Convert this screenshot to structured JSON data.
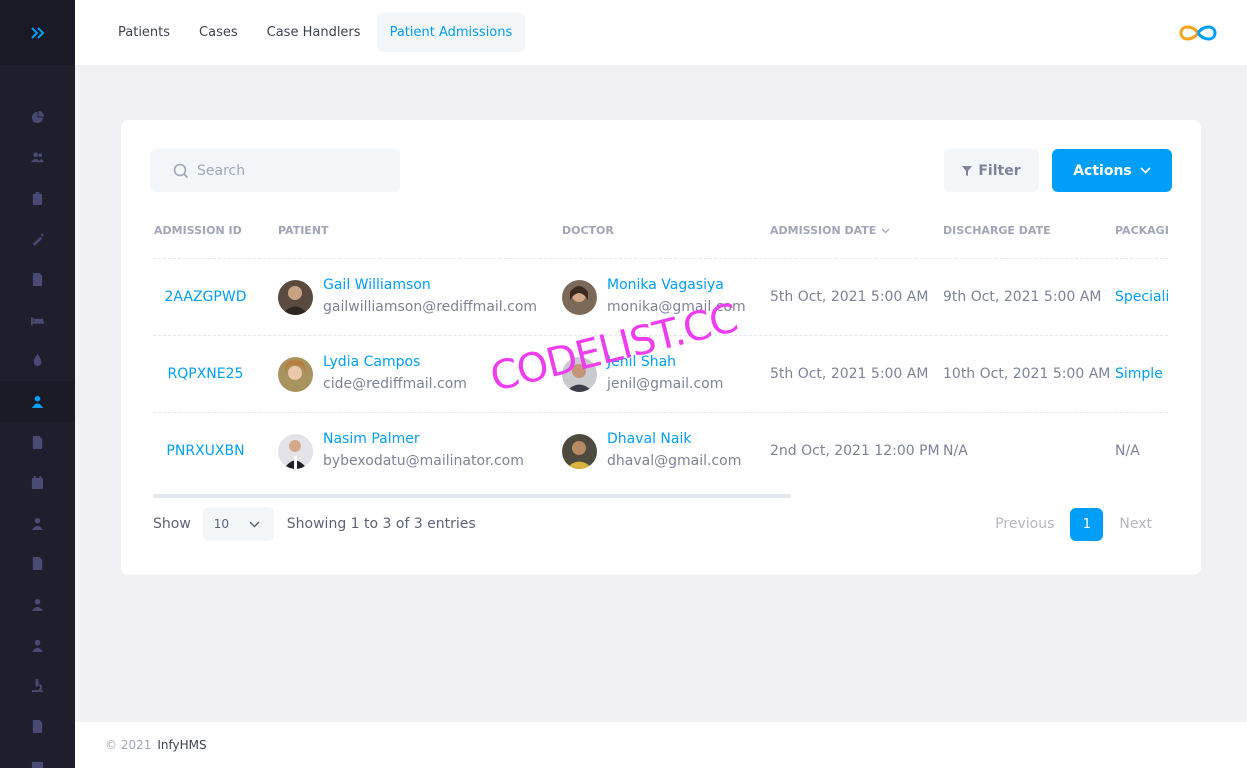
{
  "header": {
    "tabs": [
      {
        "label": "Patients",
        "active": false
      },
      {
        "label": "Cases",
        "active": false
      },
      {
        "label": "Case Handlers",
        "active": false
      },
      {
        "label": "Patient Admissions",
        "active": true
      }
    ],
    "logo_icon": "infinity-logo-icon"
  },
  "sidebar": {
    "toggle_icon": "double-chevron-right-icon",
    "items": [
      {
        "icon": "pie-chart-icon"
      },
      {
        "icon": "users-icon"
      },
      {
        "icon": "clipboard-icon"
      },
      {
        "icon": "syringe-icon"
      },
      {
        "icon": "document-icon"
      },
      {
        "icon": "bed-icon"
      },
      {
        "icon": "blood-drop-icon"
      },
      {
        "icon": "patient-icon",
        "active": true
      },
      {
        "icon": "file-icon"
      },
      {
        "icon": "calendar-icon"
      },
      {
        "icon": "user-doctor-icon"
      },
      {
        "icon": "file-text-icon"
      },
      {
        "icon": "user-nurse-icon"
      },
      {
        "icon": "user-icon"
      },
      {
        "icon": "microscope-icon"
      },
      {
        "icon": "file-medical-icon"
      },
      {
        "icon": "calendar-check-icon"
      }
    ]
  },
  "toolbar": {
    "search_placeholder": "Search",
    "filter_label": "Filter",
    "actions_label": "Actions"
  },
  "table": {
    "columns": [
      "ADMISSION ID",
      "PATIENT",
      "DOCTOR",
      "ADMISSION DATE",
      "DISCHARGE DATE",
      "PACKAGE"
    ],
    "rows": [
      {
        "admission_id": "2AAZGPWD",
        "patient_name": "Gail Williamson",
        "patient_email": "gailwilliamson@rediffmail.com",
        "doctor_name": "Monika Vagasiya",
        "doctor_email": "monika@gmail.com",
        "admission_date": "5th Oct, 2021 5:00 AM",
        "discharge_date": "9th Oct, 2021 5:00 AM",
        "package": "Speciali"
      },
      {
        "admission_id": "RQPXNE25",
        "patient_name": "Lydia Campos",
        "patient_email": "cide@rediffmail.com",
        "doctor_name": "Jenil Shah",
        "doctor_email": "jenil@gmail.com",
        "admission_date": "5th Oct, 2021 5:00 AM",
        "discharge_date": "10th Oct, 2021 5:00 AM",
        "package": "Simple I"
      },
      {
        "admission_id": "PNRXUXBN",
        "patient_name": "Nasim Palmer",
        "patient_email": "bybexodatu@mailinator.com",
        "doctor_name": "Dhaval Naik",
        "doctor_email": "dhaval@gmail.com",
        "admission_date": "2nd Oct, 2021 12:00 PM",
        "discharge_date": "N/A",
        "package": "N/A"
      }
    ]
  },
  "pagination": {
    "show_label": "Show",
    "page_size": "10",
    "showing_text": "Showing 1 to 3 of 3 entries",
    "previous_label": "Previous",
    "current_page": "1",
    "next_label": "Next"
  },
  "watermark": "CODELIST.CC",
  "footer": {
    "copyright": "© 2021",
    "brand": "InfyHMS"
  },
  "colors": {
    "accent": "#009ef7",
    "sidebar_bg": "#1e1e2d",
    "watermark": "#ee3dee"
  }
}
